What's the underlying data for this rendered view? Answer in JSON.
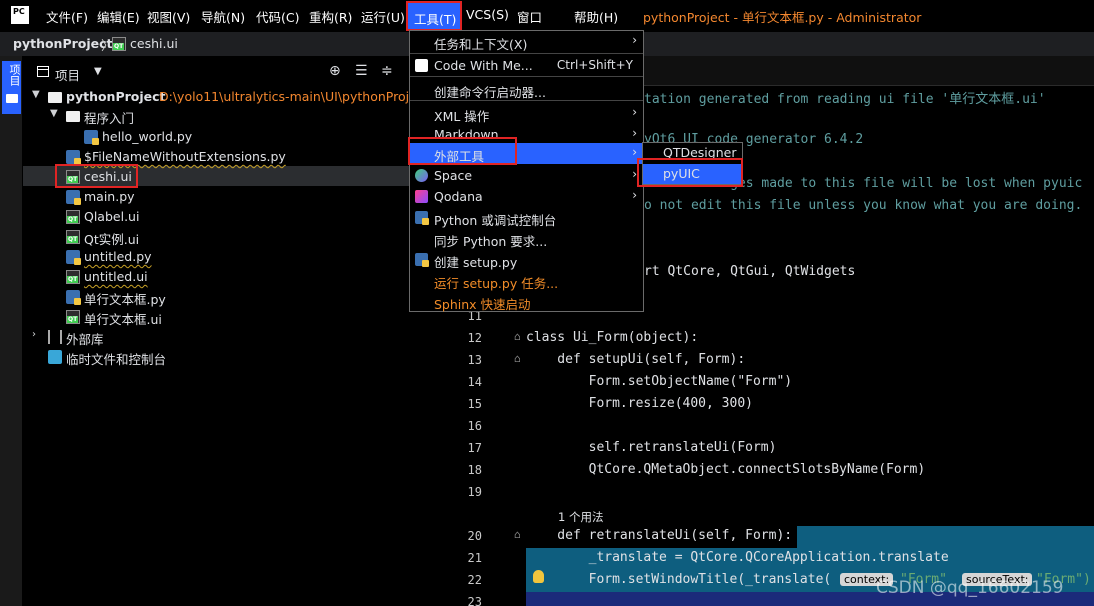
{
  "menubar": {
    "logo": "PC",
    "items": [
      "文件(F)",
      "编辑(E)",
      "视图(V)",
      "导航(N)",
      "代码(C)",
      "重构(R)",
      "运行(U)",
      "工具(T)",
      "VCS(S)",
      "窗口",
      "帮助(H)"
    ],
    "window_title": "pythonProject - 单行文本框.py - Administrator"
  },
  "breadcrumb": {
    "project": "pythonProject",
    "file": "ceshi.ui"
  },
  "left_strip": {
    "project_tab": "项目"
  },
  "project_panel": {
    "title": "项目",
    "tree": [
      {
        "label": "pythonProject",
        "path": "D:\\yolo11\\ultralytics-main\\UI\\pythonProject"
      },
      {
        "label": "程序入门"
      },
      {
        "label": "hello_world.py"
      },
      {
        "label": "$FileNameWithoutExtensions.py"
      },
      {
        "label": "ceshi.ui"
      },
      {
        "label": "main.py"
      },
      {
        "label": "Qlabel.ui"
      },
      {
        "label": "Qt实例.ui"
      },
      {
        "label": "untitled.py"
      },
      {
        "label": "untitled.ui"
      },
      {
        "label": "单行文本框.py"
      },
      {
        "label": "单行文本框.ui"
      },
      {
        "label": "外部库"
      },
      {
        "label": "临时文件和控制台"
      }
    ]
  },
  "tools_menu": {
    "items": [
      {
        "label": "任务和上下文(X)",
        "submenu": true
      },
      {
        "label": "Code With Me...",
        "shortcut": "Ctrl+Shift+Y"
      },
      {
        "label": "创建命令行启动器..."
      },
      {
        "label": "XML 操作",
        "submenu": true
      },
      {
        "label": "Markdown",
        "submenu": true
      },
      {
        "label": "外部工具",
        "submenu": true
      },
      {
        "label": "Space",
        "submenu": true
      },
      {
        "label": "Qodana",
        "submenu": true
      },
      {
        "label": "Python 或调试控制台"
      },
      {
        "label": "同步 Python 要求..."
      },
      {
        "label": "创建 setup.py"
      },
      {
        "label": "运行 setup.py 任务..."
      },
      {
        "label": "Sphinx 快速启动"
      }
    ]
  },
  "external_tools_submenu": {
    "items": [
      "QTDesigner",
      "pyUIC"
    ]
  },
  "editor": {
    "lines": [
      {
        "ln": "",
        "text": "tation generated from reading ui file '单行文本框.ui'"
      },
      {
        "ln": "",
        "text": "yQt6 UI code generator 6.4.2"
      },
      {
        "ln": "",
        "text": "manual changes made to this file will be lost when pyuic"
      },
      {
        "ln": "",
        "text": "o not edit this file unless you know what you are doing."
      },
      {
        "ln": "",
        "text": "rt QtCore, QtGui, QtWidgets"
      },
      {
        "ln": "11",
        "text": ""
      },
      {
        "ln": "12",
        "text": "class Ui_Form(object):"
      },
      {
        "ln": "13",
        "text": "    def setupUi(self, Form):"
      },
      {
        "ln": "14",
        "text": "        Form.setObjectName(\"Form\")"
      },
      {
        "ln": "15",
        "text": "        Form.resize(400, 300)"
      },
      {
        "ln": "16",
        "text": ""
      },
      {
        "ln": "17",
        "text": "        self.retranslateUi(Form)"
      },
      {
        "ln": "18",
        "text": "        QtCore.QMetaObject.connectSlotsByName(Form)"
      },
      {
        "ln": "19",
        "text": ""
      },
      {
        "ln": "20",
        "text": "    def retranslateUi(self, Form):"
      },
      {
        "ln": "21",
        "text": "        _translate = QtCore.QCoreApplication.translate"
      },
      {
        "ln": "22",
        "text": "        Form.setWindowTitle(_translate("
      },
      {
        "ln": "23",
        "text": ""
      }
    ],
    "usage_hint": "1 个用法",
    "inlay_context": "context:",
    "inlay_context_val": "\"Form\"",
    "inlay_source": "sourceText:",
    "inlay_source_val": "\"Form\")"
  },
  "watermark": "CSDN @qq_16602159",
  "colors": {
    "accent": "#2962ff",
    "highlight_box": "#e02424",
    "disabled_item": "#f28c28"
  }
}
